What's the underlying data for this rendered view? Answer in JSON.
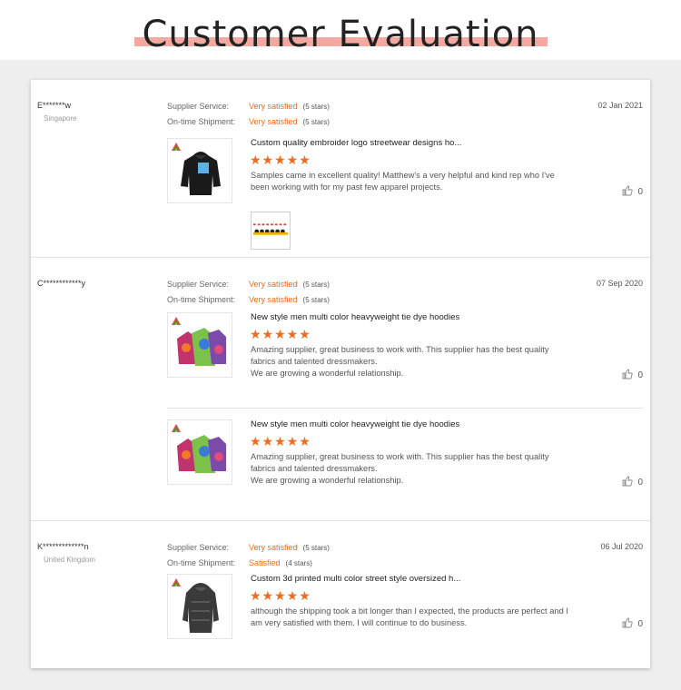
{
  "page": {
    "title": "Customer Evaluation"
  },
  "labels": {
    "supplier_service": "Supplier Service:",
    "ontime_shipment": "On-time Shipment:"
  },
  "reviews": [
    {
      "user": "E*******w",
      "country": "Singapore",
      "date": "02 Jan 2021",
      "supplier_service": {
        "value": "Very satisfied",
        "stars": "(5 stars)"
      },
      "ontime_shipment": {
        "value": "Very satisfied",
        "stars": "(5 stars)"
      },
      "products": [
        {
          "title": "Custom quality embroider logo streetwear designs ho...",
          "stars": "★★★★★",
          "rating": 5,
          "text": "Samples came in excellent quality! Matthew's a very helpful and kind rep who I've been working with for my past few apparel projects.",
          "likes": "0",
          "thumb_icon": "thumbs-up-icon",
          "image": "black-hoodie-photo",
          "attachment": "attachment-photo"
        }
      ]
    },
    {
      "user": "C************y",
      "country": "",
      "date": "07 Sep 2020",
      "supplier_service": {
        "value": "Very satisfied",
        "stars": "(5 stars)"
      },
      "ontime_shipment": {
        "value": "Very satisfied",
        "stars": "(5 stars)"
      },
      "products": [
        {
          "title": "New style men multi color heavyweight tie dye hoodies",
          "stars": "★★★★★",
          "rating": 5,
          "text": "Amazing supplier, great business to work with. This supplier has the best quality fabrics and talented dressmakers.\nWe are growing a wonderful relationship.",
          "likes": "0",
          "thumb_icon": "thumbs-up-icon",
          "image": "tie-dye-hoodies-photo"
        },
        {
          "title": "New style men multi color heavyweight tie dye hoodies",
          "stars": "★★★★★",
          "rating": 5,
          "text": "Amazing supplier, great business to work with. This supplier has the best quality fabrics and talented dressmakers.\nWe are growing a wonderful relationship.",
          "likes": "0",
          "thumb_icon": "thumbs-up-icon",
          "image": "tie-dye-hoodies-photo"
        }
      ]
    },
    {
      "user": "K*************n",
      "country": "United Kingdom",
      "date": "06 Jul 2020",
      "supplier_service": {
        "value": "Very satisfied",
        "stars": "(5 stars)"
      },
      "ontime_shipment": {
        "value": "Satisfied",
        "stars": "(4 stars)"
      },
      "products": [
        {
          "title": "Custom 3d printed multi color street style oversized h...",
          "stars": "★★★★★",
          "rating": 5,
          "text": "although the shipping took a bit longer than I expected, the products are perfect and I am very satisfied with them. I will continue to do business.",
          "likes": "0",
          "thumb_icon": "thumbs-up-icon",
          "image": "grey-hoodie-photo"
        }
      ]
    }
  ],
  "colors": {
    "accent": "#f26b1d",
    "title_bar": "#f3a9a2",
    "background": "#eeeeee"
  }
}
